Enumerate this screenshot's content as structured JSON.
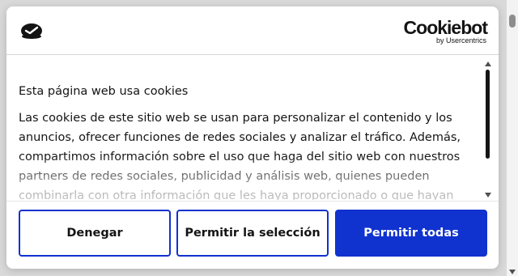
{
  "header": {
    "brand_icon": "cookie-brand-icon",
    "logo_word": "Cookiebot",
    "logo_sub": "by Usercentrics"
  },
  "content": {
    "title": "Esta página web usa cookies",
    "body": "Las cookies de este sitio web se usan para personalizar el contenido y los anuncios, ofrecer funciones de redes sociales y analizar el tráfico. Además, compartimos información sobre el uso que haga del sitio web con nuestros partners de redes sociales, publicidad y análisis web, quienes pueden combinarla con otra información que les haya proporcionado o que hayan recopilado a partir del uso que haya hecho de sus servicios."
  },
  "buttons": {
    "deny": "Denegar",
    "allow_selection": "Permitir la selección",
    "allow_all": "Permitir todas"
  },
  "colors": {
    "accent": "#1032cf",
    "text": "#141414",
    "backdrop": "#d9d9d9"
  }
}
